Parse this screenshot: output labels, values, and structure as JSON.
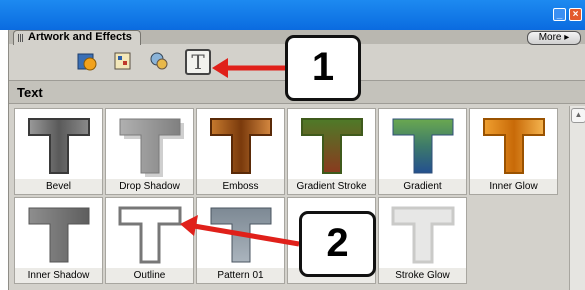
{
  "window": {
    "minimize_icon": "minimize-icon",
    "close_icon": "close-icon"
  },
  "panel": {
    "tab_label": "Artwork and Effects",
    "more_label": "More",
    "category_icons": [
      "effects-icon",
      "filters-icon",
      "layer-styles-icon",
      "text-effects-icon"
    ],
    "selected_icon_text": "T",
    "section_title": "Text"
  },
  "tiles": [
    {
      "name": "Bevel",
      "style": "bevel"
    },
    {
      "name": "Drop Shadow",
      "style": "drop-shadow"
    },
    {
      "name": "Emboss",
      "style": "emboss"
    },
    {
      "name": "Gradient Stroke",
      "style": "gradient-stroke"
    },
    {
      "name": "Gradient",
      "style": "gradient"
    },
    {
      "name": "Inner Glow",
      "style": "inner-glow"
    },
    {
      "name": "Inner Shadow",
      "style": "inner-shadow"
    },
    {
      "name": "Outline",
      "style": "outline"
    },
    {
      "name": "Pattern 01",
      "style": "pattern"
    },
    {
      "name": "",
      "style": "hidden"
    },
    {
      "name": "Stroke Glow",
      "style": "stroke-glow"
    }
  ],
  "annotations": {
    "callout_1": "1",
    "callout_2": "2",
    "arrow_color": "#e0201a"
  },
  "colors": {
    "titlebar": "#0a6be0",
    "panel": "#d3d1cb"
  }
}
